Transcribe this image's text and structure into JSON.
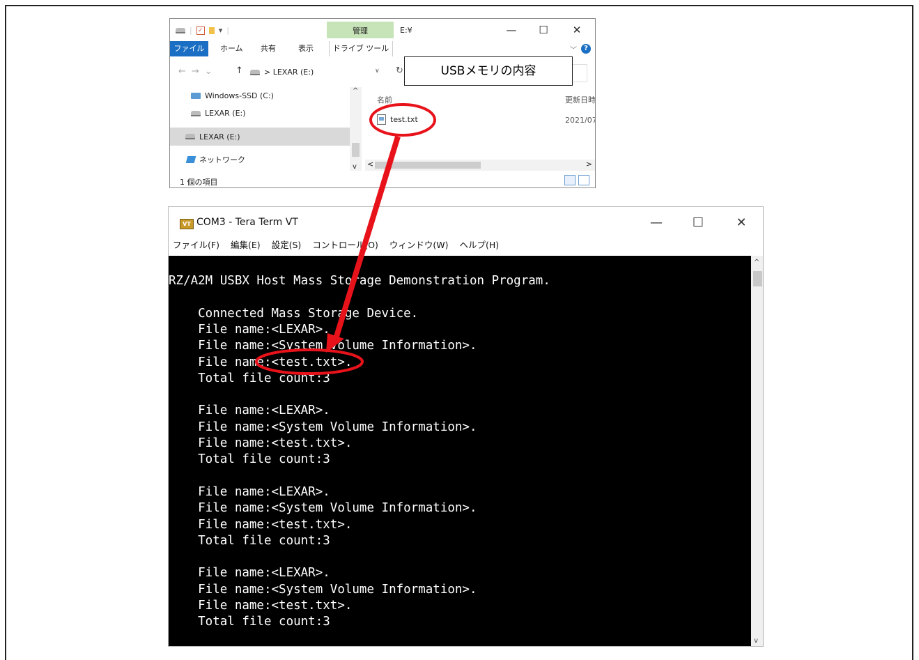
{
  "explorer": {
    "window_title": "E:¥",
    "manage_tab": "管理",
    "ribbon_tabs": [
      "ファイル",
      "ホーム",
      "共有",
      "表示"
    ],
    "drive_tools_tab": "ドライブ ツール",
    "address_path": "> LEXAR (E:)",
    "nav_items": [
      "Windows-SSD (C:)",
      "LEXAR (E:)",
      "LEXAR (E:)",
      "ネットワーク"
    ],
    "column_name": "名前",
    "column_date": "更新日時",
    "file_name": "test.txt",
    "file_date": "2021/07",
    "status_text": "1 個の項目",
    "minimize_glyph": "—",
    "maximize_glyph": "☐",
    "close_glyph": "✕"
  },
  "callout_text": "USBメモリの内容",
  "teraterm": {
    "window_title": "COM3 - Tera Term VT",
    "icon_label": "VT",
    "menu": [
      "ファイル(F)",
      "編集(E)",
      "設定(S)",
      "コントロール(O)",
      "ウィンドウ(W)",
      "ヘルプ(H)"
    ],
    "terminal_lines": [
      "RZ/A2M USBX Host Mass Storage Demonstration Program.",
      "",
      "    Connected Mass Storage Device.",
      "    File name:<LEXAR>.",
      "    File name:<System Volume Information>.",
      "    File name:<test.txt>.",
      "    Total file count:3",
      "",
      "    File name:<LEXAR>.",
      "    File name:<System Volume Information>.",
      "    File name:<test.txt>.",
      "    Total file count:3",
      "",
      "    File name:<LEXAR>.",
      "    File name:<System Volume Information>.",
      "    File name:<test.txt>.",
      "    Total file count:3",
      "",
      "    File name:<LEXAR>.",
      "    File name:<System Volume Information>.",
      "    File name:<test.txt>.",
      "    Total file count:3"
    ]
  },
  "colors": {
    "annotation": "#e8121a",
    "terminal_bg": "#000000",
    "terminal_fg": "#ffffff",
    "ribbon_file_tab": "#1a6fc4",
    "manage_tab": "#c7e3b8"
  }
}
